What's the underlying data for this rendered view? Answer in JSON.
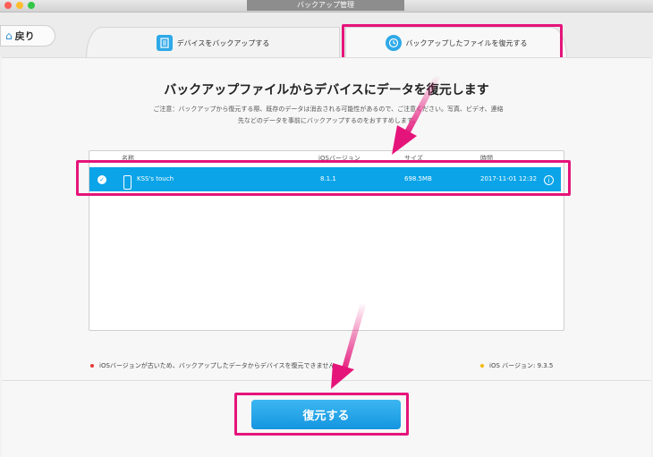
{
  "window": {
    "title": "バックアップ管理"
  },
  "toolbar": {
    "back_label": "戻り",
    "tabs": [
      {
        "label": "デバイスをバックアップする",
        "icon": "document-icon"
      },
      {
        "label": "バックアップしたファイルを復元する",
        "icon": "history-icon"
      }
    ]
  },
  "main": {
    "heading": "バックアップファイルからデバイスにデータを復元します",
    "notice_line1": "ご注意：バックアップから復元する際、既存のデータは消去される可能性があるので、ご注意ください。写真、ビデオ、連絡",
    "notice_line2": "先などのデータを事前にバックアップするのをおすすめします。",
    "table": {
      "headers": {
        "name": "名称",
        "ios": "iOSバージョン",
        "size": "サイズ",
        "time": "時間"
      },
      "rows": [
        {
          "name": "KSS's touch",
          "ios": "8.1.1",
          "size": "698.5MB",
          "time": "2017-11-01 12:32",
          "selected": true
        }
      ]
    },
    "footnote_left": "iOSバージョンが古いため、バックアップしたデータからデバイスを復元できません。",
    "footnote_right": "iOS バージョン: 9.3.5",
    "restore_button": "復元する"
  },
  "colors": {
    "accent": "#0ba4e8",
    "highlight": "#e5147a",
    "warning_dot_red": "#e53935",
    "warning_dot_yellow": "#f5b800"
  }
}
